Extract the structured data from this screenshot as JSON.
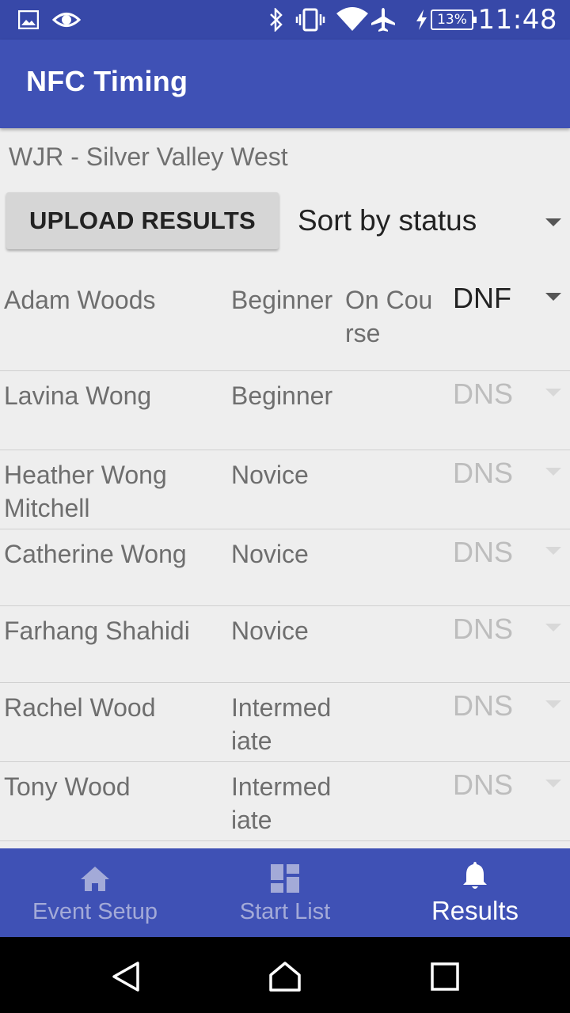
{
  "statusbar": {
    "time": "11:48",
    "battery": "13%",
    "icons": [
      "image-icon",
      "eye-icon",
      "bluetooth-icon",
      "vibrate-icon",
      "wifi-icon",
      "airplane-icon",
      "charging-icon"
    ]
  },
  "appbar": {
    "title": "NFC Timing"
  },
  "event": {
    "name": "WJR - Silver Valley West"
  },
  "controls": {
    "upload_label": "UPLOAD RESULTS",
    "sort_value": "Sort by status"
  },
  "results": [
    {
      "name": "Adam Woods",
      "level": "Beginner",
      "status": "On Course",
      "result": "DNF",
      "active": true
    },
    {
      "name": "Lavina Wong",
      "level": "Beginner",
      "status": "",
      "result": "DNS",
      "active": false
    },
    {
      "name": "Heather Wong Mitchell",
      "level": "Novice",
      "status": "",
      "result": "DNS",
      "active": false
    },
    {
      "name": "Catherine Wong",
      "level": "Novice",
      "status": "",
      "result": "DNS",
      "active": false
    },
    {
      "name": "Farhang Shahidi",
      "level": "Novice",
      "status": "",
      "result": "DNS",
      "active": false
    },
    {
      "name": "Rachel Wood",
      "level": "Intermediate",
      "status": "",
      "result": "DNS",
      "active": false
    },
    {
      "name": "Tony Wood",
      "level": "Intermediate",
      "status": "",
      "result": "DNS",
      "active": false
    }
  ],
  "bottomnav": {
    "items": [
      {
        "label": "Event Setup",
        "icon": "home-icon",
        "selected": false
      },
      {
        "label": "Start List",
        "icon": "dashboard-icon",
        "selected": false
      },
      {
        "label": "Results",
        "icon": "bell-icon",
        "selected": true
      }
    ]
  },
  "colors": {
    "primary": "#3f51b5",
    "primary_dark": "#3748a8",
    "background": "#eeeeee"
  }
}
